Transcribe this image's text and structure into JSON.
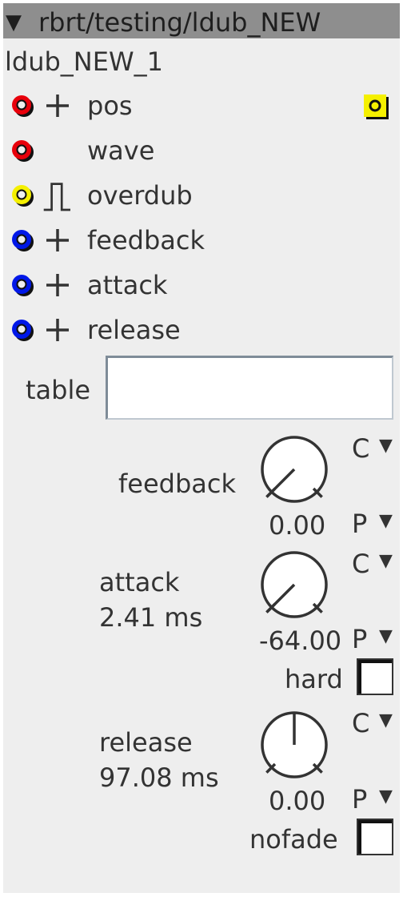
{
  "window": {
    "title": "rbrt/testing/ldub_NEW",
    "collapse_arrow": "▼"
  },
  "instance_name": "ldub_NEW_1",
  "status_icon": "yellow-square-indicator",
  "ports": [
    {
      "label": "pos",
      "color": "#e8000b",
      "symbol": "+"
    },
    {
      "label": "wave",
      "color": "#e8000b",
      "symbol": ""
    },
    {
      "label": "overdub",
      "color": "#f5f000",
      "symbol": "gate"
    },
    {
      "label": "feedback",
      "color": "#0018e8",
      "symbol": "+"
    },
    {
      "label": "attack",
      "color": "#0018e8",
      "symbol": "+"
    },
    {
      "label": "release",
      "color": "#0018e8",
      "symbol": "+"
    }
  ],
  "table": {
    "label": "table",
    "value": ""
  },
  "controls": {
    "feedback": {
      "label": "feedback",
      "readout": "",
      "value": "0.00",
      "mode_c": "C",
      "mode_p": "P",
      "level": 0.0
    },
    "attack": {
      "label": "attack",
      "readout": "2.41 ms",
      "value": "-64.00",
      "mode_c": "C",
      "mode_p": "P",
      "level": -64.0
    },
    "release": {
      "label": "release",
      "readout": "97.08 ms",
      "value": "0.00",
      "mode_c": "C",
      "mode_p": "P",
      "level": 0.0
    }
  },
  "toggles": {
    "hard": {
      "label": "hard",
      "checked": false
    },
    "nofade": {
      "label": "nofade",
      "checked": false
    }
  },
  "dropdown_arrow": "▼"
}
